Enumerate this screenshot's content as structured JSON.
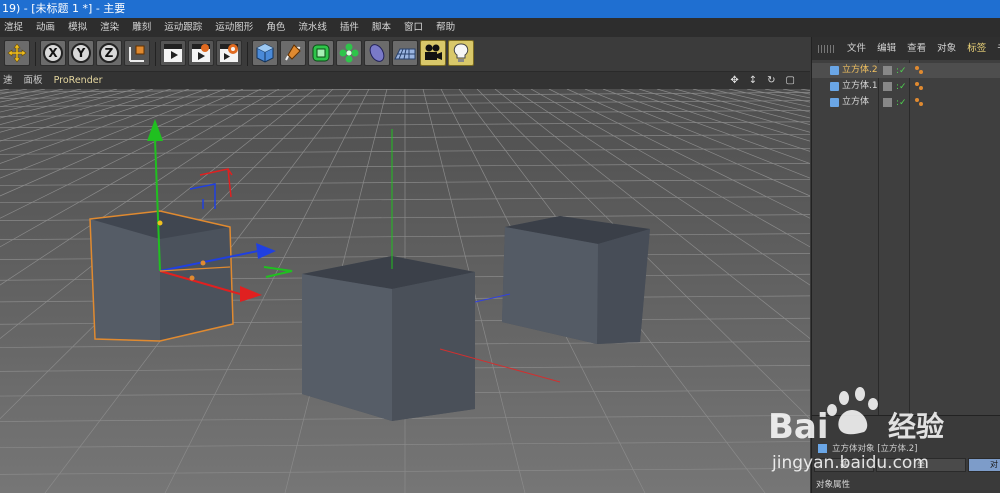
{
  "window": {
    "title": "19) - [未标题 1 *] - 主要"
  },
  "menu": [
    "渲捉",
    "动画",
    "模拟",
    "渲染",
    "雕刻",
    "运动跟踪",
    "运动图形",
    "角色",
    "流水线",
    "插件",
    "脚本",
    "窗口",
    "帮助"
  ],
  "toolbar": {
    "axis_x": "X",
    "axis_y": "Y",
    "axis_z": "Z",
    "icons": [
      "move-icon",
      "axis-x-icon",
      "axis-y-icon",
      "axis-z-icon",
      "coord-system-icon",
      "render-view-icon",
      "render-picture-viewer-icon",
      "render-settings-icon",
      "cube-icon",
      "pen-icon",
      "subdivision-icon",
      "mograph-cloner-icon",
      "deformer-icon",
      "floor-icon",
      "camera-icon",
      "light-icon"
    ]
  },
  "viewport_menu": {
    "items": [
      "速",
      "面板",
      "ProRender"
    ]
  },
  "objects_panel": {
    "tabs": [
      "文件",
      "编辑",
      "查看",
      "对象",
      "标签",
      "书签"
    ],
    "active_tab": "标签",
    "rows": [
      {
        "name": "立方体.2",
        "selected": true
      },
      {
        "name": "立方体.1",
        "selected": false
      },
      {
        "name": "立方体",
        "selected": false
      }
    ]
  },
  "attributes_panel": {
    "object_info": "立方体对象 [立方体.2]",
    "tab_fragment_1": "基",
    "tab_fragment_2": "坐",
    "tab_fragment_3": "对",
    "section_label": "对象属性"
  },
  "watermark": {
    "brand": "Bai",
    "brand2": "经验",
    "url": "jingyan.baidu.com"
  },
  "colors": {
    "titlebar": "#1f6fd1",
    "selected_object": "#f0c060",
    "axis_x": "#e02020",
    "axis_y": "#20c020",
    "axis_z": "#2040e0",
    "selection_outline": "#e08a30"
  }
}
